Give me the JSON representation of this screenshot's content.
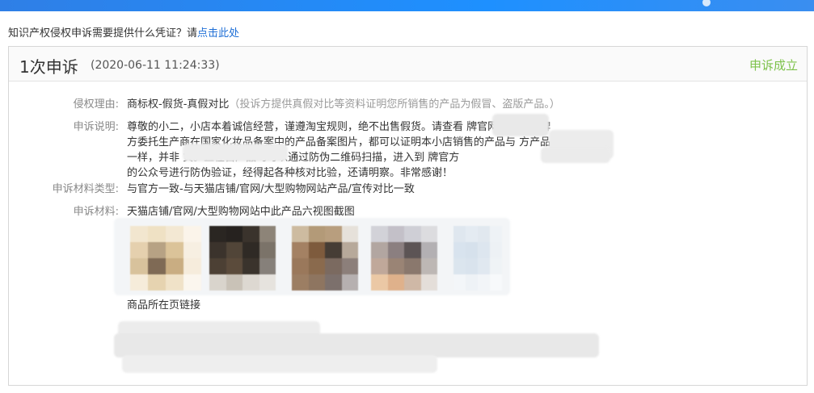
{
  "help": {
    "question": "知识产权侵权申诉需要提供什么凭证？请",
    "link": "点击此处"
  },
  "appeal": {
    "title": "1次申诉",
    "time": "(2020-06-11 11:24:33)",
    "status": "申诉成立",
    "status_color": "#7dc24b",
    "fields": {
      "reason_label": "侵权理由:",
      "reason_value": "商标权-假货-真假对比",
      "reason_hint": "（投诉方提供真假对比等资料证明您所销售的产品为假冒、盗版产品。）",
      "desc_label": "申诉说明:",
      "desc_lines": [
        "尊敬的小二，小店本着诚信经营，谨遵淘宝规则，绝不出售假货。请查看          牌官网图片及品牌",
        "方委托生产商在国家化妆品备案中的产品备案图片，都可以证明本小店销售的产品与              方产品",
        "一样，并非                      货。且在售产品均可以通过防伪二维码扫描，进入到                  牌官方",
        "的公众号进行防伪验证，经得起各种核对比验，还请明察。非常感谢！"
      ],
      "material_type_label": "申诉材料类型:",
      "material_type_value": "与官方一致-与天猫店铺/官网/大型购物网站产品/宣传对比一致",
      "material_label": "申诉材料:",
      "material_value": "天猫店铺/官网/大型购物网站中此产品六视图截图",
      "link_label": "商品所在页链接"
    }
  }
}
